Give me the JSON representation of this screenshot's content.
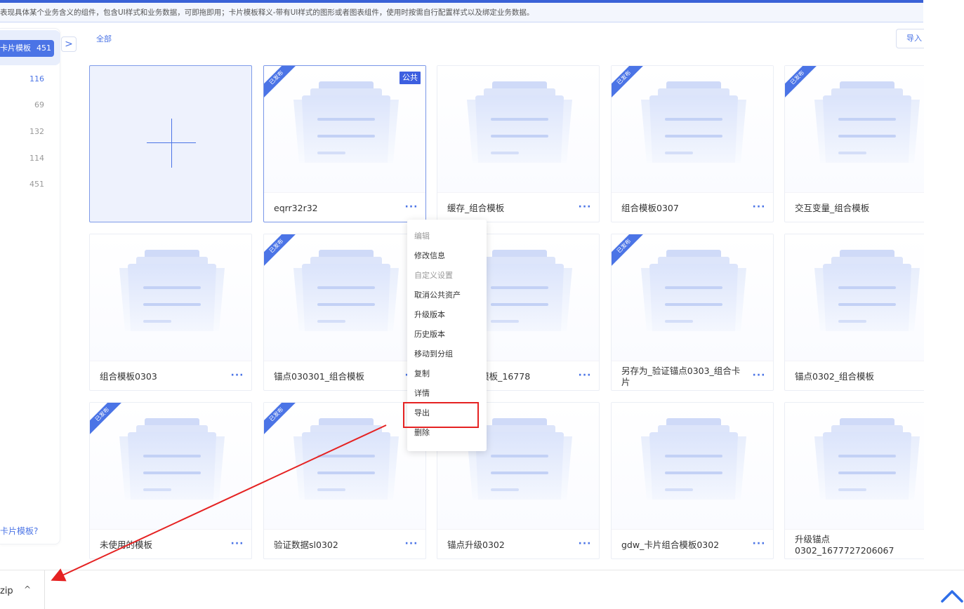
{
  "description": "表现具体某个业务含义的组件，包含UI样式和业务数据，可即拖即用；卡片模板释义-带有UI样式的图形或者图表组件，使用时按需自行配置样式以及绑定业务数据。",
  "sidebar": {
    "active_label": "卡片模板",
    "active_count": "451",
    "counts": [
      "116",
      "69",
      "132",
      "114",
      "451"
    ],
    "help_link": "卡片模板?"
  },
  "toolbar": {
    "filter_all": "全部",
    "import_label": "导入"
  },
  "cards": [
    {
      "name": "eqrr32r32",
      "published": true,
      "badge": "公共"
    },
    {
      "name": "缓存_组合模板",
      "published": false
    },
    {
      "name": "组合模板0307",
      "published": true
    },
    {
      "name": "交互变量_组合模板",
      "published": true
    },
    {
      "name": "组合模板0303",
      "published": false
    },
    {
      "name": "锚点030301_组合模板",
      "published": true
    },
    {
      "name": "01_组合模板_16778",
      "published": false
    },
    {
      "name": "另存为_验证锚点0303_组合卡片",
      "published": true
    },
    {
      "name": "锚点0302_组合模板",
      "published": false
    },
    {
      "name": "未使用的模板",
      "published": true
    },
    {
      "name": "验证数据sl0302",
      "published": true
    },
    {
      "name": "锚点升级0302",
      "published": false
    },
    {
      "name": "gdw_卡片组合模板0302",
      "published": false
    },
    {
      "name": "升级锚点0302_1677727206067",
      "published": false
    }
  ],
  "ribbon_label": "已发布",
  "more_label": "···",
  "context_menu": [
    {
      "label": "编辑",
      "group": true
    },
    {
      "label": "修改信息",
      "group": false
    },
    {
      "label": "自定义设置",
      "group": true
    },
    {
      "label": "取消公共资产",
      "group": false
    },
    {
      "label": "升级版本",
      "group": false
    },
    {
      "label": "历史版本",
      "group": false
    },
    {
      "label": "移动到分组",
      "group": false
    },
    {
      "label": "复制",
      "group": false
    },
    {
      "label": "详情",
      "group": false
    },
    {
      "label": "导出",
      "group": false
    },
    {
      "label": "删除",
      "group": false
    }
  ],
  "download_bar": {
    "file_label": "zip",
    "chevron": "^"
  },
  "colors": {
    "accent": "#4b74e6",
    "highlight": "#e52222"
  }
}
